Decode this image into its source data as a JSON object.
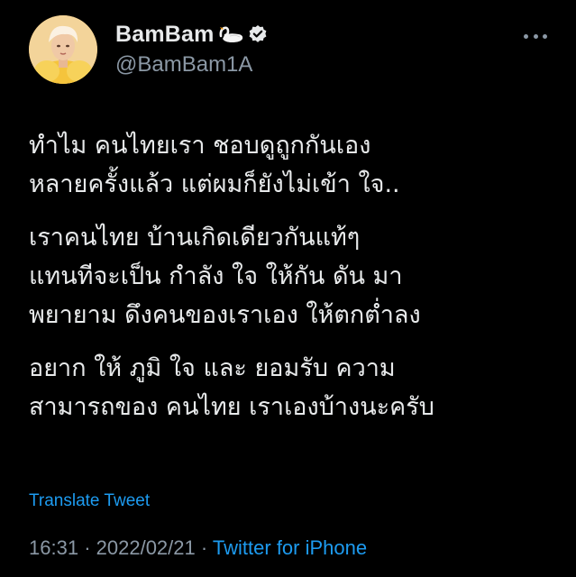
{
  "author": {
    "display_name": "BamBam",
    "handle": "@BamBam1A",
    "verified": true,
    "emoji": "swan"
  },
  "tweet": {
    "paragraphs": [
      [
        "ทำไม คนไทยเรา ชอบดูถูกกันเอง",
        "หลายครั้งแล้ว แต่ผมก็ยังไม่เข้า ใจ.."
      ],
      [
        "เราคนไทย บ้านเกิดเดียวกันแท้ๆ",
        "แทนทีจะเป็น กำลัง ใจ ให้กัน ดัน มา",
        "พยายาม ดึงคนของเราเอง  ให้ตกต่ำลง"
      ],
      [
        "อยาก ให้ ภูมิ ใจ และ ยอมรับ ความ",
        "สามารถของ คนไทย เราเองบ้างนะครับ"
      ]
    ],
    "translate_label": "Translate Tweet",
    "time": "16:31",
    "date": "2022/02/21",
    "separator": "·",
    "source": "Twitter for iPhone"
  },
  "icons": {
    "more": "more-dots-icon",
    "verified": "verified-badge-icon",
    "swan": "swan-emoji-icon"
  },
  "colors": {
    "background": "#000000",
    "text": "#e7e9ea",
    "secondary": "#8b98a5",
    "link": "#1d9bf0"
  }
}
